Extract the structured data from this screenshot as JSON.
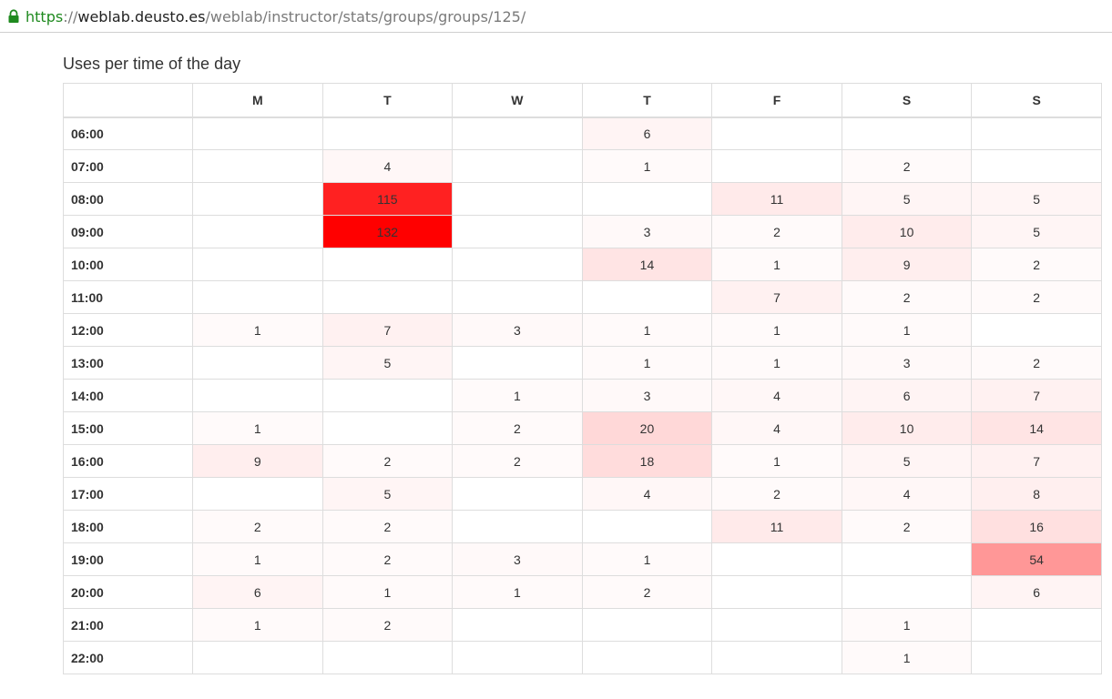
{
  "browser": {
    "url_scheme": "https",
    "url_separator": "://",
    "url_host": "weblab.deusto.es",
    "url_path": "/weblab/instructor/stats/groups/groups/125/",
    "lock_color": "#1f8a1f"
  },
  "page": {
    "title": "Uses per time of the day"
  },
  "table": {
    "corner": "",
    "days": [
      "M",
      "T",
      "W",
      "T",
      "F",
      "S",
      "S"
    ],
    "max_value": 132,
    "heat_color": "#ff0000",
    "rows": [
      {
        "hour": "06:00",
        "values": [
          null,
          null,
          null,
          6,
          null,
          null,
          null
        ]
      },
      {
        "hour": "07:00",
        "values": [
          null,
          4,
          null,
          1,
          null,
          2,
          null
        ]
      },
      {
        "hour": "08:00",
        "values": [
          null,
          115,
          null,
          null,
          11,
          5,
          5
        ]
      },
      {
        "hour": "09:00",
        "values": [
          null,
          132,
          null,
          3,
          2,
          10,
          5
        ]
      },
      {
        "hour": "10:00",
        "values": [
          null,
          null,
          null,
          14,
          1,
          9,
          2
        ]
      },
      {
        "hour": "11:00",
        "values": [
          null,
          null,
          null,
          null,
          7,
          2,
          2
        ]
      },
      {
        "hour": "12:00",
        "values": [
          1,
          7,
          3,
          1,
          1,
          1,
          null
        ]
      },
      {
        "hour": "13:00",
        "values": [
          null,
          5,
          null,
          1,
          1,
          3,
          2
        ]
      },
      {
        "hour": "14:00",
        "values": [
          null,
          null,
          1,
          3,
          4,
          6,
          7
        ]
      },
      {
        "hour": "15:00",
        "values": [
          1,
          null,
          2,
          20,
          4,
          10,
          14
        ]
      },
      {
        "hour": "16:00",
        "values": [
          9,
          2,
          2,
          18,
          1,
          5,
          7
        ]
      },
      {
        "hour": "17:00",
        "values": [
          null,
          5,
          null,
          4,
          2,
          4,
          8
        ]
      },
      {
        "hour": "18:00",
        "values": [
          2,
          2,
          null,
          null,
          11,
          2,
          16
        ]
      },
      {
        "hour": "19:00",
        "values": [
          1,
          2,
          3,
          1,
          null,
          null,
          54
        ]
      },
      {
        "hour": "20:00",
        "values": [
          6,
          1,
          1,
          2,
          null,
          null,
          6
        ]
      },
      {
        "hour": "21:00",
        "values": [
          1,
          2,
          null,
          null,
          null,
          1,
          null
        ]
      },
      {
        "hour": "22:00",
        "values": [
          null,
          null,
          null,
          null,
          null,
          1,
          null
        ]
      }
    ]
  }
}
